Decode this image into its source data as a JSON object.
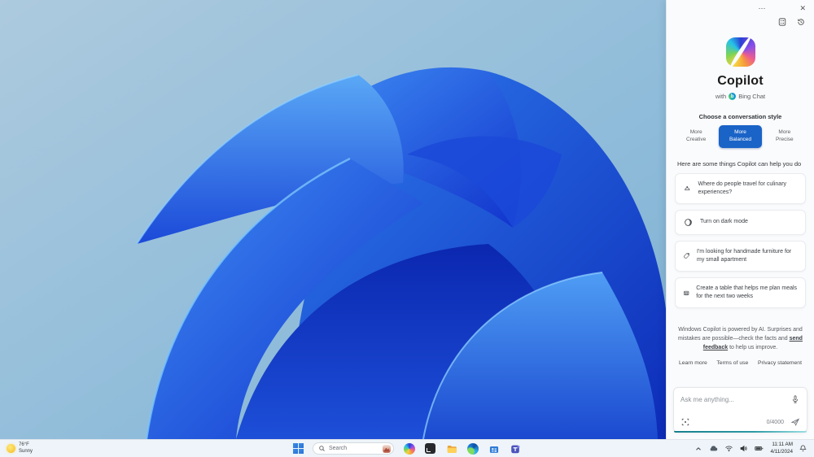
{
  "colors": {
    "accent_blue": "#1a63c7",
    "teal_accent": "#177f8d",
    "panel_bg": "#fafbfc",
    "wallpaper_sky": "#9cc2dc",
    "bloom_blue": "#1e54e0"
  },
  "copilot_panel": {
    "window_controls": {
      "more_glyph": "⋯",
      "close_glyph": "✕"
    },
    "title": "Copilot",
    "subtitle_prefix": "with",
    "bing_badge_letter": "b",
    "subtitle_suffix": "Bing Chat",
    "style_chooser": {
      "label": "Choose a conversation style",
      "options": [
        {
          "line1": "More",
          "line2": "Creative",
          "selected": false
        },
        {
          "line1": "More",
          "line2": "Balanced",
          "selected": true
        },
        {
          "line1": "More",
          "line2": "Precise",
          "selected": false
        }
      ]
    },
    "suggestions_heading": "Here are some things Copilot can help you do",
    "suggestions": [
      {
        "icon": "cloche-icon",
        "text": "Where do people travel for culinary experiences?"
      },
      {
        "icon": "dark-mode-icon",
        "text": "Turn on dark mode"
      },
      {
        "icon": "tag-icon",
        "text": "I'm looking for handmade furniture for my small apartment"
      },
      {
        "icon": "table-icon",
        "text": "Create a table that helps me plan meals for the next two weeks"
      }
    ],
    "disclaimer": {
      "text_before": "Windows Copilot is powered by AI. Surprises and mistakes are possible—check the facts and ",
      "link": "send feedback",
      "text_after": " to help us improve."
    },
    "footer_links": [
      "Learn more",
      "Terms of use",
      "Privacy statement"
    ],
    "input": {
      "placeholder": "Ask me anything...",
      "char_counter": "0/4000"
    }
  },
  "taskbar": {
    "weather": {
      "temp": "76°F",
      "condition": "Sunny"
    },
    "search_placeholder": "Search",
    "tray": {
      "time": "11:11 AM",
      "date": "4/11/2024"
    }
  }
}
